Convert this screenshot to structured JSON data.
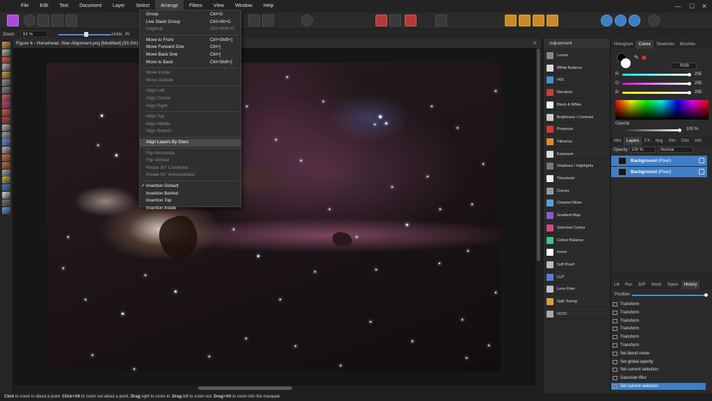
{
  "menubar": {
    "items": [
      "File",
      "Edit",
      "Text",
      "Document",
      "Layer",
      "Select",
      "Arrange",
      "Filters",
      "View",
      "Window",
      "Help"
    ],
    "active": "Arrange"
  },
  "context_bar": {
    "zoom_label": "Zoom",
    "zoom_value": "93 %",
    "units_label": "Units:",
    "units_value": "Pi"
  },
  "document": {
    "tab_title": "Figure 6 - Horsehead -Star-Alignment.png [Modified] (93.3%)",
    "close": "✕"
  },
  "arrange_menu": {
    "items": [
      {
        "label": "Group",
        "shortcut": "Ctrl+G",
        "state": "enabled"
      },
      {
        "label": "Live Stack Group",
        "shortcut": "Ctrl+Alt+G",
        "state": "enabled"
      },
      {
        "label": "Ungroup",
        "shortcut": "Ctrl+Shift+G",
        "state": "disabled"
      },
      {
        "sep": true
      },
      {
        "label": "Move to Front",
        "shortcut": "Ctrl+Shift+]",
        "state": "enabled"
      },
      {
        "label": "Move Forward One",
        "shortcut": "Ctrl+]",
        "state": "enabled"
      },
      {
        "label": "Move Back One",
        "shortcut": "Ctrl+[",
        "state": "enabled"
      },
      {
        "label": "Move to Back",
        "shortcut": "Ctrl+Shift+[",
        "state": "enabled"
      },
      {
        "sep": true
      },
      {
        "label": "Move Inside",
        "shortcut": "",
        "state": "disabled"
      },
      {
        "label": "Move Outside",
        "shortcut": "",
        "state": "disabled"
      },
      {
        "sep": true
      },
      {
        "label": "Align Left",
        "shortcut": "",
        "state": "disabled"
      },
      {
        "label": "Align Centre",
        "shortcut": "",
        "state": "disabled"
      },
      {
        "label": "Align Right",
        "shortcut": "",
        "state": "disabled"
      },
      {
        "sep": true
      },
      {
        "label": "Align Top",
        "shortcut": "",
        "state": "disabled"
      },
      {
        "label": "Align Middle",
        "shortcut": "",
        "state": "disabled"
      },
      {
        "label": "Align Bottom",
        "shortcut": "",
        "state": "disabled"
      },
      {
        "sep": true
      },
      {
        "label": "Align Layers By Stars",
        "shortcut": "",
        "state": "highlighted"
      },
      {
        "sep": true
      },
      {
        "label": "Flip Horizontal",
        "shortcut": "",
        "state": "disabled"
      },
      {
        "label": "Flip Vertical",
        "shortcut": "",
        "state": "disabled"
      },
      {
        "label": "Rotate 90° Clockwise",
        "shortcut": "",
        "state": "disabled"
      },
      {
        "label": "Rotate 90° Anticlockwise",
        "shortcut": "",
        "state": "disabled"
      },
      {
        "sep": true
      },
      {
        "label": "Insertion Default",
        "shortcut": "",
        "state": "enabled",
        "checked": true
      },
      {
        "label": "Insertion Behind",
        "shortcut": "",
        "state": "enabled"
      },
      {
        "label": "Insertion Top",
        "shortcut": "",
        "state": "enabled"
      },
      {
        "label": "Insertion Inside",
        "shortcut": "",
        "state": "enabled"
      }
    ],
    "checkmark": "✓"
  },
  "adjustment_panel": {
    "title": "Adjustment",
    "items": [
      {
        "label": "Levels",
        "color": "#888888"
      },
      {
        "label": "White Balance",
        "color": "#d9d9d9"
      },
      {
        "label": "HSL",
        "color": "#4a8fd8"
      },
      {
        "label": "Recolour",
        "color": "#c04040"
      },
      {
        "label": "Black & White",
        "color": "#f0f0f0"
      },
      {
        "label": "Brightness / Contrast",
        "color": "#cccccc"
      },
      {
        "label": "Posterise",
        "color": "#d03a3a"
      },
      {
        "label": "Vibrance",
        "color": "#e08a30"
      },
      {
        "label": "Exposure",
        "color": "#dddddd"
      },
      {
        "label": "Shadows / Highlights",
        "color": "#777777"
      },
      {
        "label": "Threshold",
        "color": "#eeeeee"
      },
      {
        "label": "Curves",
        "color": "#999999"
      },
      {
        "label": "Channel Mixer",
        "color": "#5aa0e0"
      },
      {
        "label": "Gradient Map",
        "color": "#8a5ad0"
      },
      {
        "label": "Selective Colour",
        "color": "#d04a8a"
      },
      {
        "label": "Colour Balance",
        "color": "#4ac08a"
      },
      {
        "label": "Invert",
        "color": "#ffffff"
      },
      {
        "label": "Soft Proof",
        "color": "#bbbbbb"
      },
      {
        "label": "LUT",
        "color": "#5a7ad0"
      },
      {
        "label": "Lens Filter",
        "color": "#c0c0c0"
      },
      {
        "label": "Split Toning",
        "color": "#e0a040"
      },
      {
        "label": "OCIO",
        "color": "#aaaaaa"
      }
    ]
  },
  "colour_panel": {
    "tabs": [
      "Histogram",
      "Colour",
      "Swatches",
      "Brushes"
    ],
    "active_tab": "Colour",
    "mode": "RGB",
    "channels": [
      {
        "label": "R:",
        "value": "255"
      },
      {
        "label": "G:",
        "value": "255"
      },
      {
        "label": "B:",
        "value": "255"
      }
    ],
    "opacity_label": "Opacity",
    "opacity_value": "100 %"
  },
  "layers_panel": {
    "tabs": [
      "Mtd",
      "Layers",
      "FX",
      "Nvg",
      "Xfm",
      "Chn",
      "Info"
    ],
    "active_tab": "Layers",
    "opacity_label": "Opacity:",
    "opacity_value": "100 %",
    "blend_mode": "Normal",
    "layers": [
      {
        "name": "Background",
        "kind": "(Pixel)"
      },
      {
        "name": "Background",
        "kind": "(Pixel)"
      }
    ]
  },
  "history_panel": {
    "tabs": [
      "Lib",
      "Rec",
      "32P",
      "Stock",
      "Styles",
      "History"
    ],
    "active_tab": "History",
    "position_label": "Position:",
    "items": [
      "Transform",
      "Transform",
      "Transform",
      "Transform",
      "Transform",
      "Transform",
      "Set blend mode",
      "Set global opacity",
      "Set current selection",
      "Gaussian Blur",
      "Set current selection"
    ],
    "selected_index": 10
  },
  "status": {
    "segments": [
      {
        "text": "Click",
        "bold": true
      },
      {
        "text": " to zoom in about a point. ",
        "bold": false
      },
      {
        "text": "Click+Alt",
        "bold": true
      },
      {
        "text": " to zoom out about a point. ",
        "bold": false
      },
      {
        "text": "Drag",
        "bold": true
      },
      {
        "text": " right to zoom in. ",
        "bold": false
      },
      {
        "text": "Drag",
        "bold": true
      },
      {
        "text": " left to zoom out. ",
        "bold": false
      },
      {
        "text": "Drag+Alt",
        "bold": true
      },
      {
        "text": " to zoom into the marquee.",
        "bold": false
      }
    ]
  },
  "window_controls": {
    "minimize": "—",
    "maximize": "☐",
    "close": "✕"
  }
}
